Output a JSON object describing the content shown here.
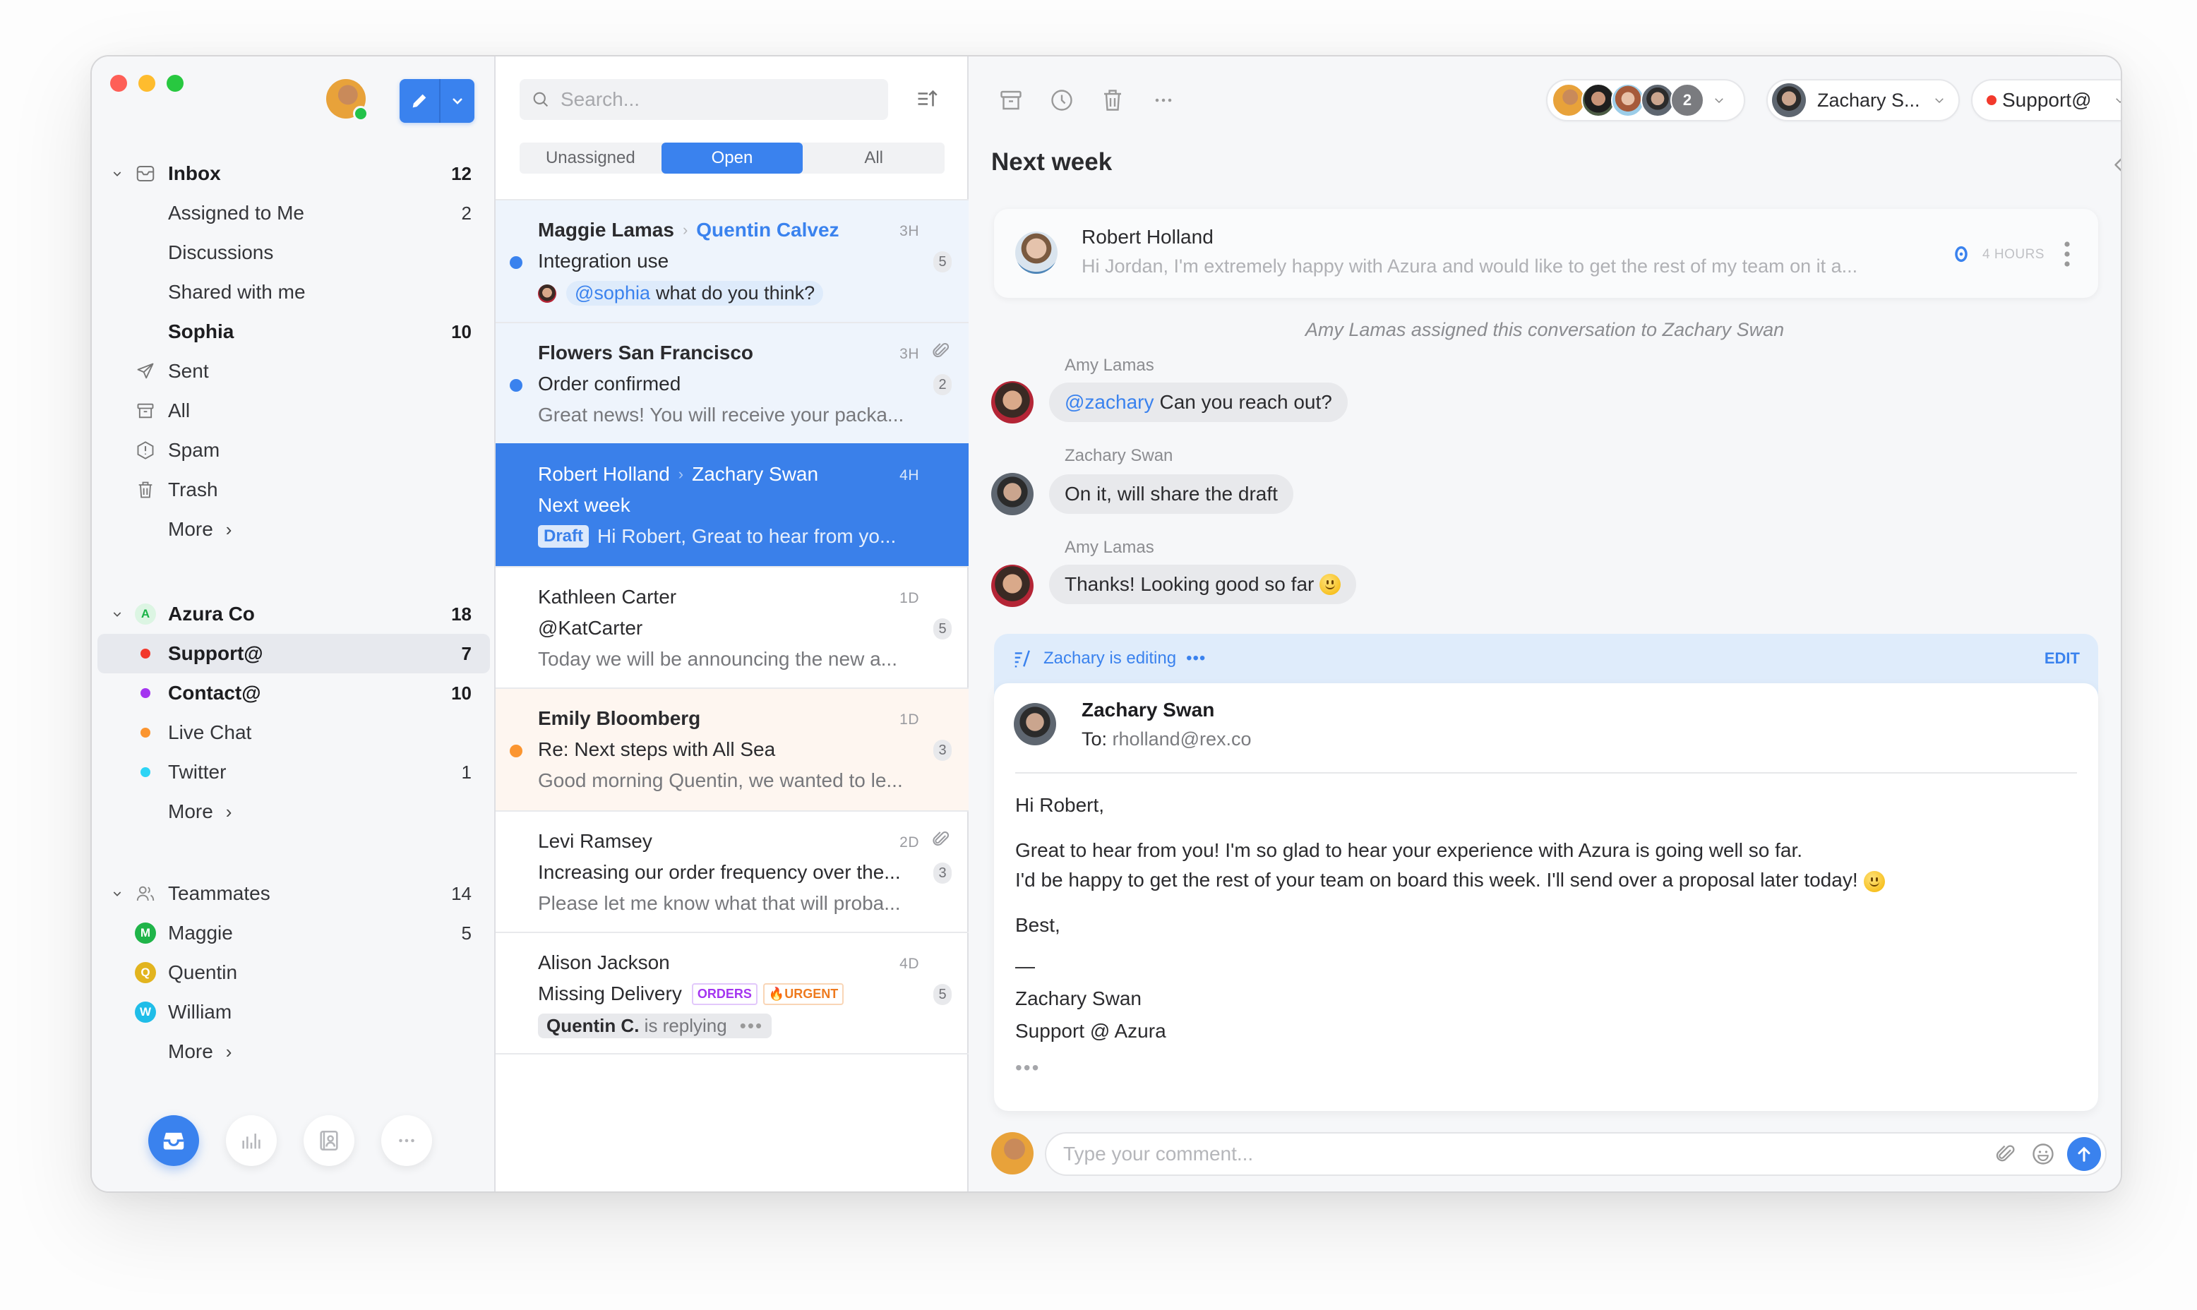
{
  "window": {
    "traffic_lights": [
      "close",
      "minimize",
      "zoom"
    ]
  },
  "sidebar": {
    "compose_button_icon": "pencil-icon",
    "inbox": {
      "label": "Inbox",
      "count": "12",
      "items": [
        {
          "label": "Assigned to Me",
          "count": "2"
        },
        {
          "label": "Discussions",
          "count": ""
        },
        {
          "label": "Shared with me",
          "count": ""
        },
        {
          "label": "Sophia",
          "count": "10"
        }
      ]
    },
    "folders": [
      {
        "label": "Sent",
        "icon": "send-icon"
      },
      {
        "label": "All",
        "icon": "archive-icon"
      },
      {
        "label": "Spam",
        "icon": "spam-icon"
      },
      {
        "label": "Trash",
        "icon": "trash-icon"
      }
    ],
    "more_label": "More",
    "team": {
      "label": "Azura Co",
      "letter": "A",
      "count": "18",
      "items": [
        {
          "label": "Support@",
          "count": "7",
          "color": "#f2392c"
        },
        {
          "label": "Contact@",
          "count": "10",
          "color": "#a435f0"
        },
        {
          "label": "Live Chat",
          "count": "",
          "color": "#fb9530"
        },
        {
          "label": "Twitter",
          "count": "1",
          "color": "#2dd4f5"
        }
      ]
    },
    "teammates": {
      "label": "Teammates",
      "count": "14",
      "items": [
        {
          "label": "Maggie",
          "letter": "M",
          "count": "5",
          "color": "#1fb449"
        },
        {
          "label": "Quentin",
          "letter": "Q",
          "count": "",
          "color": "#e2b41f"
        },
        {
          "label": "William",
          "letter": "W",
          "count": "",
          "color": "#20bde8"
        }
      ]
    },
    "bottom_nav": [
      "inbox-icon",
      "analytics-icon",
      "contacts-icon",
      "more-icon"
    ]
  },
  "list": {
    "search_placeholder": "Search...",
    "tabs": [
      {
        "label": "Unassigned",
        "active": false
      },
      {
        "label": "Open",
        "active": true
      },
      {
        "label": "All",
        "active": false
      }
    ],
    "conversations": [
      {
        "from": "Maggie Lamas",
        "to": "Quentin Calvez",
        "time": "3H",
        "subject": "Integration use",
        "mention": "@sophia",
        "preview": "what do you think?",
        "count": "5"
      },
      {
        "from": "Flowers San Francisco",
        "time": "3H",
        "subject": "Order confirmed",
        "preview": "Great news! You will receive your packa...",
        "count": "2"
      },
      {
        "from": "Robert Holland",
        "to": "Zachary Swan",
        "time": "4H",
        "subject": "Next week",
        "draft_label": "Draft",
        "preview": "Hi Robert, Great to hear from yo..."
      },
      {
        "from": "Kathleen Carter",
        "time": "1D",
        "subject": "@KatCarter",
        "preview": "Today we will be announcing the new a...",
        "count": "5"
      },
      {
        "from": "Emily Bloomberg",
        "time": "1D",
        "subject": "Re: Next steps with All Sea",
        "preview": "Good morning Quentin, we wanted to le...",
        "count": "3"
      },
      {
        "from": "Levi Ramsey",
        "time": "2D",
        "subject": "Increasing our order frequency over the...",
        "preview": "Please let me know what that will proba...",
        "count": "3"
      },
      {
        "from": "Alison Jackson",
        "time": "4D",
        "subject": "Missing Delivery",
        "tags": [
          "ORDERS",
          "URGENT"
        ],
        "replying_name": "Quentin C.",
        "replying_text": "is replying",
        "count": "5"
      }
    ]
  },
  "detail": {
    "toolbar": [
      "archive-icon",
      "snooze-icon",
      "trash-icon",
      "more-icon"
    ],
    "participants_extra": "2",
    "assignee": "Zachary S...",
    "inbox_label": "Support@",
    "inbox_color": "#f2392c",
    "subject": "Next week",
    "email": {
      "from": "Robert Holland",
      "preview": "Hi Jordan, I'm extremely happy with Azura and would like to get the rest of my team on it a...",
      "time": "4 HOURS"
    },
    "event": "Amy Lamas assigned this conversation to Zachary Swan",
    "messages": [
      {
        "author": "Amy Lamas",
        "mention": "@zachary",
        "text": "Can you reach out?"
      },
      {
        "author": "Zachary Swan",
        "text": "On it, will share the draft"
      },
      {
        "author": "Amy Lamas",
        "text": "Thanks! Looking good so far"
      }
    ],
    "draft": {
      "editing_label": "Zachary is editing",
      "edit_button": "EDIT",
      "from": "Zachary Swan",
      "to_label": "To:",
      "to": "rholland@rex.co",
      "greeting": "Hi Robert,",
      "line1": "Great to hear from you! I'm so glad to hear your experience with Azura is going well so far.",
      "line2": "I'd be happy to get the rest of your team on board this week. I'll send over a proposal later today!",
      "signoff": "Best,",
      "dash": "—",
      "sig_name": "Zachary Swan",
      "sig_team": "Support @ Azura"
    },
    "comment_placeholder": "Type your comment..."
  }
}
